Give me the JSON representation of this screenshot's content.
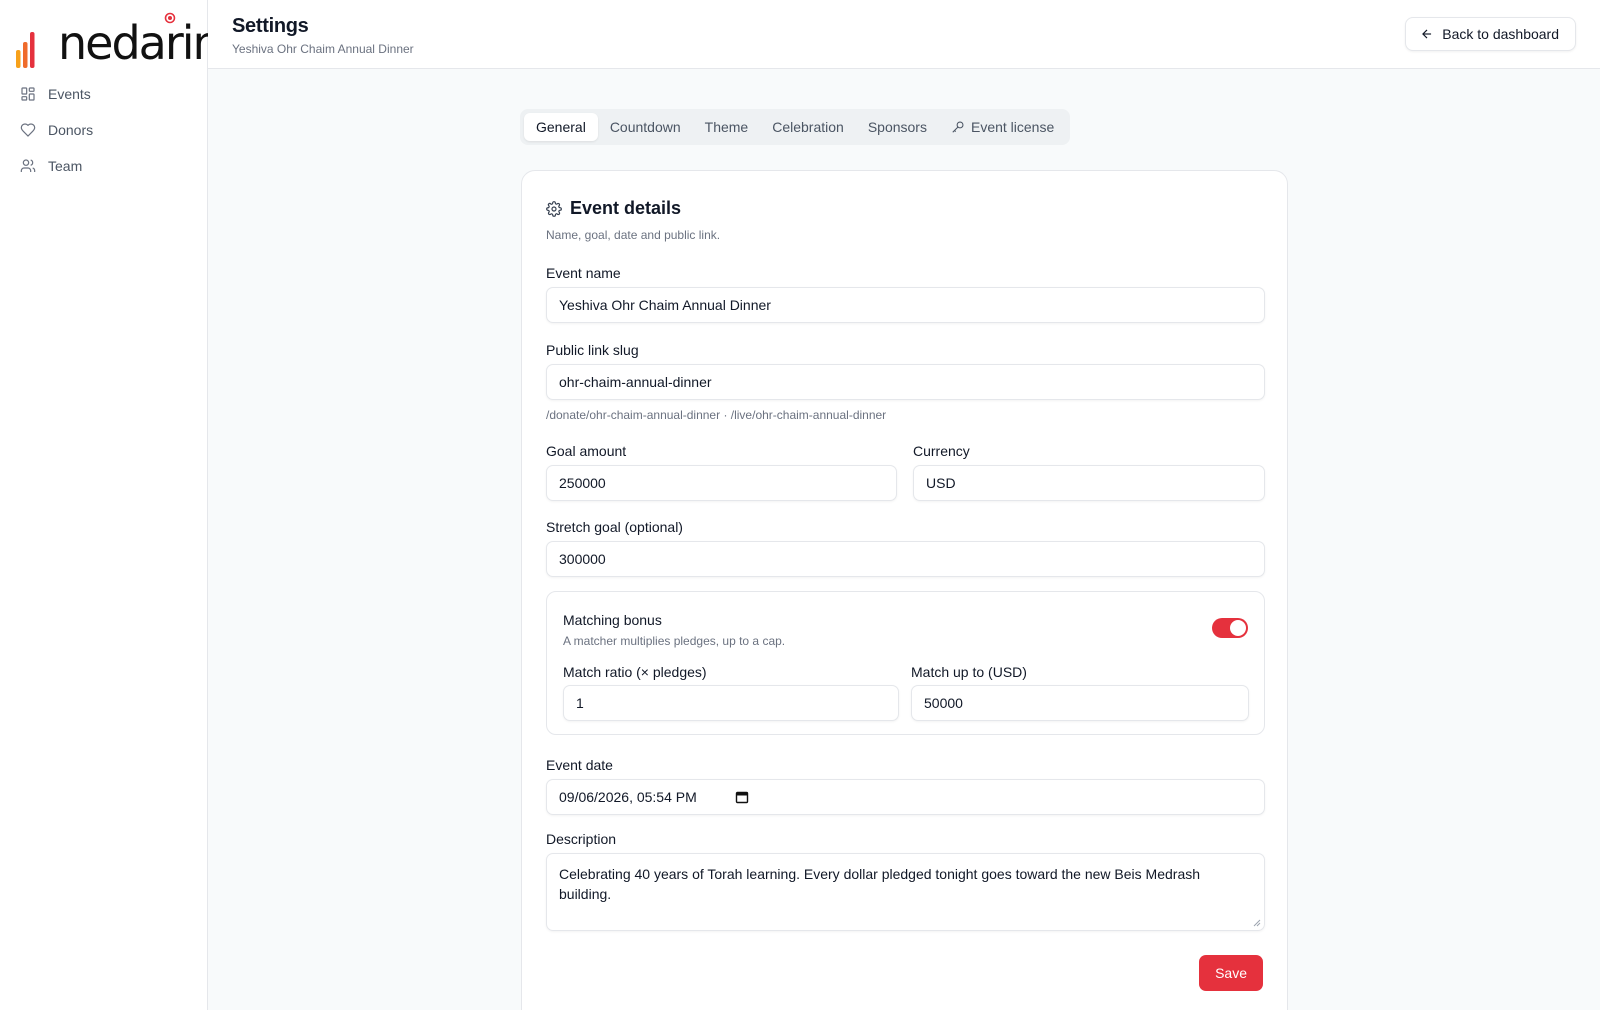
{
  "brand": {
    "name": "nedarim",
    "accent": "#e5313d"
  },
  "sidebar": {
    "items": [
      {
        "label": "Events",
        "icon": "grid-icon"
      },
      {
        "label": "Donors",
        "icon": "heart-icon"
      },
      {
        "label": "Team",
        "icon": "users-icon"
      }
    ]
  },
  "header": {
    "title": "Settings",
    "subtitle": "Yeshiva Ohr Chaim Annual Dinner",
    "back_label": "Back to dashboard"
  },
  "tabs": [
    {
      "label": "General",
      "active": true
    },
    {
      "label": "Countdown"
    },
    {
      "label": "Theme"
    },
    {
      "label": "Celebration"
    },
    {
      "label": "Sponsors"
    },
    {
      "label": "Event license",
      "icon": "key-icon"
    }
  ],
  "card": {
    "title": "Event details",
    "description": "Name, goal, date and public link."
  },
  "form": {
    "event_name": {
      "label": "Event name",
      "value": "Yeshiva Ohr Chaim Annual Dinner"
    },
    "slug": {
      "label": "Public link slug",
      "value": "ohr-chaim-annual-dinner",
      "hint": "/donate/ohr-chaim-annual-dinner · /live/ohr-chaim-annual-dinner"
    },
    "goal": {
      "label": "Goal amount",
      "value": "250000"
    },
    "currency": {
      "label": "Currency",
      "value": "USD"
    },
    "stretch": {
      "label": "Stretch goal (optional)",
      "value": "300000"
    },
    "matching": {
      "title": "Matching bonus",
      "description": "A matcher multiplies pledges, up to a cap.",
      "enabled": true,
      "ratio_label": "Match ratio (× pledges)",
      "ratio_value": "1",
      "cap_label": "Match up to (USD)",
      "cap_value": "50000"
    },
    "date": {
      "label": "Event date",
      "value": "09/06/2026, 05:54 PM"
    },
    "description": {
      "label": "Description",
      "value": "Celebrating 40 years of Torah learning. Every dollar pledged tonight goes toward the new Beis Medrash building."
    },
    "save_label": "Save"
  }
}
